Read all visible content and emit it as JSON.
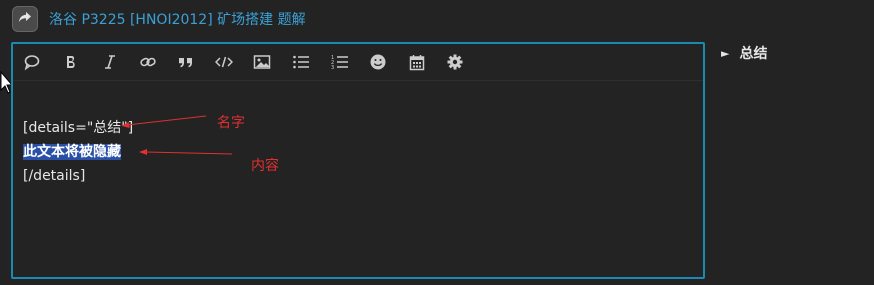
{
  "header": {
    "reply_icon": "reply-arrow-icon",
    "topic_title": "洛谷 P3225 [HNOI2012] 矿场搭建 题解"
  },
  "toolbar": {
    "items": [
      {
        "icon": "speech-bubble-icon",
        "name": "quote"
      },
      {
        "icon": "bold-icon",
        "name": "bold"
      },
      {
        "icon": "italic-icon",
        "name": "italic"
      },
      {
        "icon": "link-icon",
        "name": "link"
      },
      {
        "icon": "blockquote-icon",
        "name": "blockquote"
      },
      {
        "icon": "code-icon",
        "name": "code"
      },
      {
        "icon": "image-icon",
        "name": "image"
      },
      {
        "icon": "bullet-list-icon",
        "name": "bullet-list"
      },
      {
        "icon": "numbered-list-icon",
        "name": "numbered-list"
      },
      {
        "icon": "emoji-icon",
        "name": "emoji"
      },
      {
        "icon": "calendar-icon",
        "name": "date"
      },
      {
        "icon": "gear-icon",
        "name": "options"
      }
    ]
  },
  "editor": {
    "line1": "[details=\"总结\"]",
    "line2_selected": "此文本将被隐藏",
    "line3": "[/details]"
  },
  "annotations": {
    "name_label": "名字",
    "content_label": "内容",
    "color": "#e03030"
  },
  "preview": {
    "summary_label": "总结",
    "triangle": "►"
  },
  "colors": {
    "accent": "#1a8ab3",
    "link": "#3ba0d6",
    "selection": "#2a4fa6"
  }
}
